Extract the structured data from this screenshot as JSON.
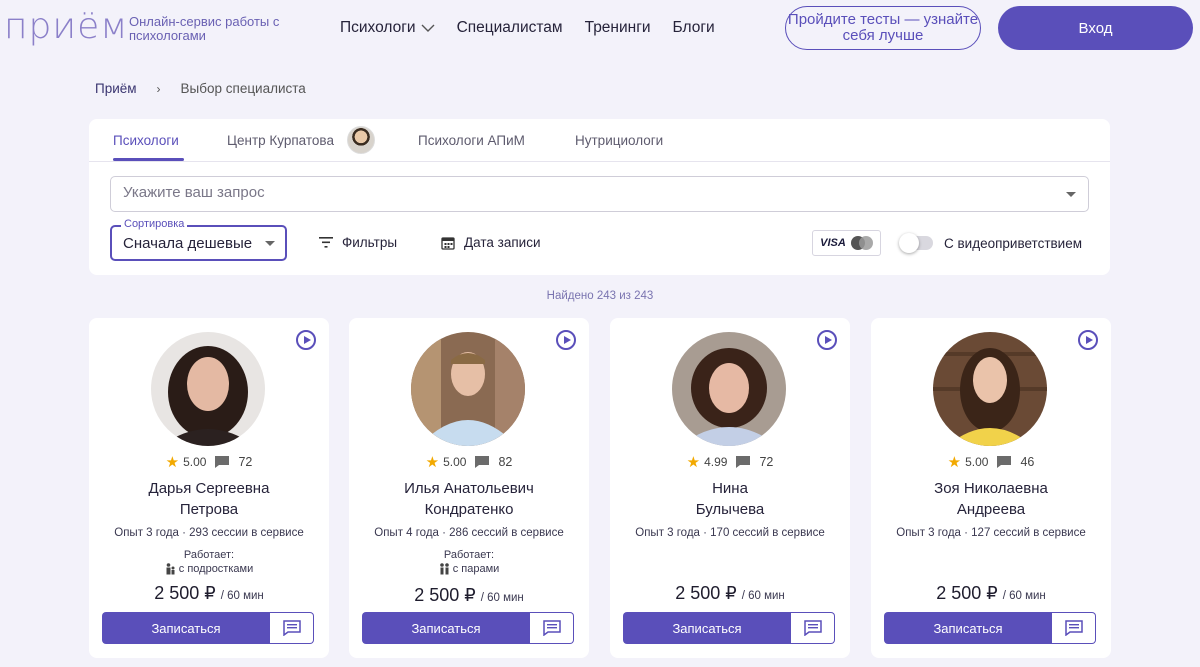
{
  "header": {
    "logo": "приём",
    "tagline": "Онлайн-сервис работы с психологами",
    "nav": [
      {
        "label": "Психологи"
      },
      {
        "label": "Специалистам"
      },
      {
        "label": "Тренинги"
      },
      {
        "label": "Блоги"
      }
    ],
    "tests_button": "Пройдите тесты — узнайте себя лучше",
    "login_button": "Вход"
  },
  "breadcrumb": {
    "home": "Приём",
    "separator": "›",
    "current": "Выбор специалиста"
  },
  "tabs": [
    {
      "label": "Психологи",
      "active": true
    },
    {
      "label": "Центр Курпатова"
    },
    {
      "label": "Психологи АПиМ"
    },
    {
      "label": "Нутрициологи"
    }
  ],
  "search": {
    "placeholder": "Укажите ваш запрос"
  },
  "sort": {
    "label": "Сортировка",
    "value": "Сначала дешевые"
  },
  "filters": {
    "filters_label": "Фильтры",
    "date_label": "Дата записи"
  },
  "payment": {
    "visa": "VISA"
  },
  "video_toggle": {
    "label": "С видеоприветствием",
    "on": false
  },
  "found_text": "Найдено 243 из 243",
  "cards": [
    {
      "rating": "5.00",
      "reviews": "72",
      "name_line1": "Дарья Сергеевна",
      "name_line2": "Петрова",
      "experience": "Опыт 3 года · 293 сессии в сервисе",
      "works_label": "Работает:",
      "works_value": "с подростками",
      "price": "2 500 ₽",
      "price_unit": "/ 60 мин",
      "book": "Записаться"
    },
    {
      "rating": "5.00",
      "reviews": "82",
      "name_line1": "Илья Анатольевич",
      "name_line2": "Кондратенко",
      "experience": "Опыт 4 года · 286 сессий в сервисе",
      "works_label": "Работает:",
      "works_value": "с парами",
      "price": "2 500 ₽",
      "price_unit": "/ 60 мин",
      "book": "Записаться"
    },
    {
      "rating": "4.99",
      "reviews": "72",
      "name_line1": "Нина",
      "name_line2": "Булычева",
      "experience": "Опыт 3 года · 170 сессий в сервисе",
      "price": "2 500 ₽",
      "price_unit": "/ 60 мин",
      "book": "Записаться"
    },
    {
      "rating": "5.00",
      "reviews": "46",
      "name_line1": "Зоя Николаевна",
      "name_line2": "Андреева",
      "experience": "Опыт 3 года · 127 сессий в сервисе",
      "price": "2 500 ₽",
      "price_unit": "/ 60 мин",
      "book": "Записаться"
    }
  ],
  "colors": {
    "accent": "#5a4fba",
    "logo": "#8b80c9",
    "star": "#f2a900",
    "background": "#f3f2fa"
  }
}
